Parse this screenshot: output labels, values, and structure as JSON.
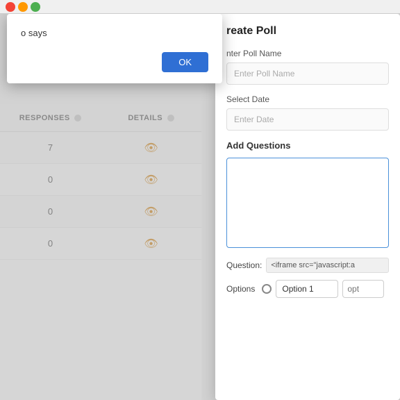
{
  "browser": {
    "icons": [
      "red",
      "orange",
      "green"
    ]
  },
  "background": {
    "page_text": "o says"
  },
  "table": {
    "headers": [
      {
        "label": "RESPONSES",
        "id": "responses"
      },
      {
        "label": "DETAILS",
        "id": "details"
      }
    ],
    "rows": [
      {
        "responses": "7",
        "has_detail": true
      },
      {
        "responses": "0",
        "has_detail": true
      },
      {
        "responses": "0",
        "has_detail": true
      },
      {
        "responses": "0",
        "has_detail": true
      }
    ],
    "eye_symbol": "👁"
  },
  "alert_dialog": {
    "text": "o says",
    "ok_label": "OK"
  },
  "create_poll": {
    "title": "reate Poll",
    "poll_name_label": "nter Poll Name",
    "poll_name_placeholder": "Enter Poll Name",
    "date_label": "Select Date",
    "date_placeholder": "Enter Date",
    "questions_label": "Add Questions",
    "question_label": "Question:",
    "question_value": "<iframe src=\"javascript:a",
    "options_label": "Options",
    "option1_value": "Option 1",
    "option2_placeholder": "opt"
  }
}
